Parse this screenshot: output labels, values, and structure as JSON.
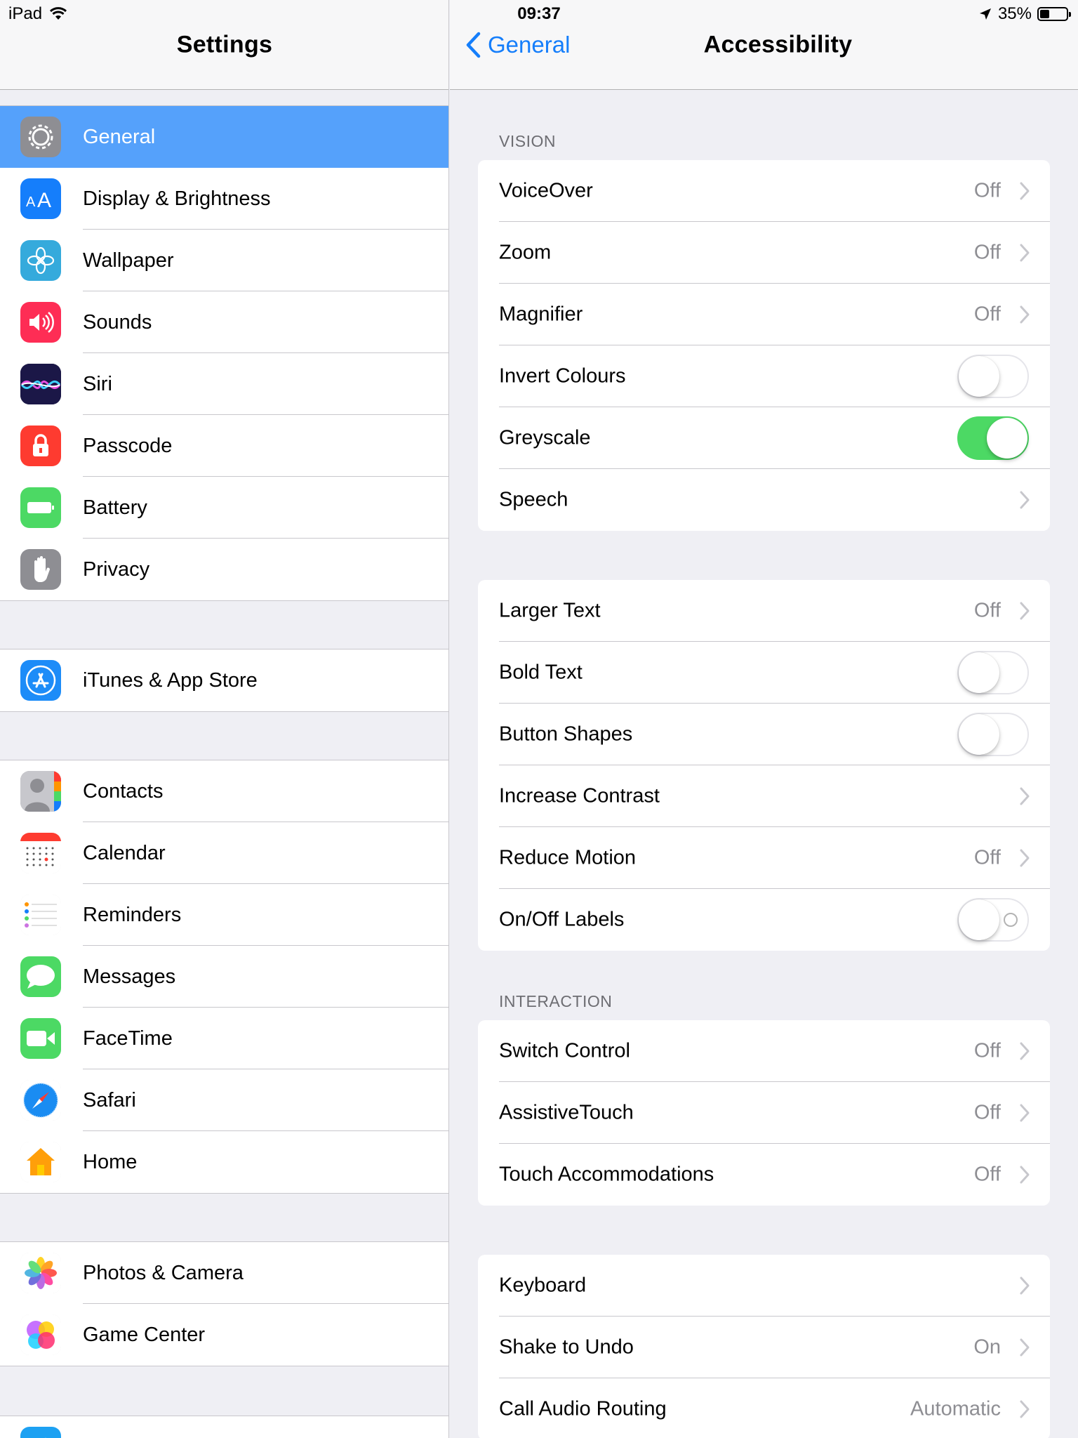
{
  "status": {
    "device": "iPad",
    "time": "09:37",
    "battery": "35%",
    "battery_level": 0.35
  },
  "master": {
    "title": "Settings",
    "groups": [
      [
        {
          "label": "General",
          "icon": "gear-icon",
          "color": "#8e8e93",
          "selected": true
        },
        {
          "label": "Display & Brightness",
          "icon": "text-size-icon",
          "color": "#157efb"
        },
        {
          "label": "Wallpaper",
          "icon": "flower-icon",
          "color": "#35aadc"
        },
        {
          "label": "Sounds",
          "icon": "speaker-icon",
          "color": "#fe2d55"
        },
        {
          "label": "Siri",
          "icon": "siri-icon",
          "color": "#1c1c3a"
        },
        {
          "label": "Passcode",
          "icon": "lock-icon",
          "color": "#fe3b30"
        },
        {
          "label": "Battery",
          "icon": "battery-icon",
          "color": "#4cd964"
        },
        {
          "label": "Privacy",
          "icon": "hand-icon",
          "color": "#8e8e93"
        }
      ],
      [
        {
          "label": "iTunes & App Store",
          "icon": "app-store-icon",
          "color": "#1d8cf8"
        }
      ],
      [
        {
          "label": "Contacts",
          "icon": "contacts-icon",
          "color": "#a7a7ac"
        },
        {
          "label": "Calendar",
          "icon": "calendar-icon",
          "color": "#ffffff"
        },
        {
          "label": "Reminders",
          "icon": "reminders-icon",
          "color": "#ffffff"
        },
        {
          "label": "Messages",
          "icon": "message-bubble-icon",
          "color": "#4cd964"
        },
        {
          "label": "FaceTime",
          "icon": "video-camera-icon",
          "color": "#4cd964"
        },
        {
          "label": "Safari",
          "icon": "compass-icon",
          "color": "#ffffff"
        },
        {
          "label": "Home",
          "icon": "house-icon",
          "color": "#ffffff"
        }
      ],
      [
        {
          "label": "Photos & Camera",
          "icon": "photos-icon",
          "color": "#ffffff"
        },
        {
          "label": "Game Center",
          "icon": "game-center-icon",
          "color": "#ffffff"
        }
      ],
      [
        {
          "label": "",
          "icon": "twitter-icon",
          "color": "#1da1f2"
        }
      ]
    ]
  },
  "detail": {
    "back_label": "General",
    "title": "Accessibility",
    "sections": [
      {
        "header": "VISION",
        "rows": [
          {
            "label": "VoiceOver",
            "value": "Off",
            "kind": "disclosure"
          },
          {
            "label": "Zoom",
            "value": "Off",
            "kind": "disclosure"
          },
          {
            "label": "Magnifier",
            "value": "Off",
            "kind": "disclosure"
          },
          {
            "label": "Invert Colours",
            "kind": "toggle",
            "on": false
          },
          {
            "label": "Greyscale",
            "kind": "toggle",
            "on": true
          },
          {
            "label": "Speech",
            "value": "",
            "kind": "disclosure"
          }
        ]
      },
      {
        "header": "",
        "rows": [
          {
            "label": "Larger Text",
            "value": "Off",
            "kind": "disclosure"
          },
          {
            "label": "Bold Text",
            "kind": "toggle",
            "on": false
          },
          {
            "label": "Button Shapes",
            "kind": "toggle",
            "on": false
          },
          {
            "label": "Increase Contrast",
            "value": "",
            "kind": "disclosure"
          },
          {
            "label": "Reduce Motion",
            "value": "Off",
            "kind": "disclosure"
          },
          {
            "label": "On/Off Labels",
            "kind": "toggle",
            "on": false,
            "labels": true
          }
        ]
      },
      {
        "header": "INTERACTION",
        "rows": [
          {
            "label": "Switch Control",
            "value": "Off",
            "kind": "disclosure"
          },
          {
            "label": "AssistiveTouch",
            "value": "Off",
            "kind": "disclosure"
          },
          {
            "label": "Touch Accommodations",
            "value": "Off",
            "kind": "disclosure"
          }
        ]
      },
      {
        "header": "",
        "rows": [
          {
            "label": "Keyboard",
            "value": "",
            "kind": "disclosure"
          },
          {
            "label": "Shake to Undo",
            "value": "On",
            "kind": "disclosure"
          },
          {
            "label": "Call Audio Routing",
            "value": "Automatic",
            "kind": "disclosure"
          }
        ]
      }
    ]
  }
}
